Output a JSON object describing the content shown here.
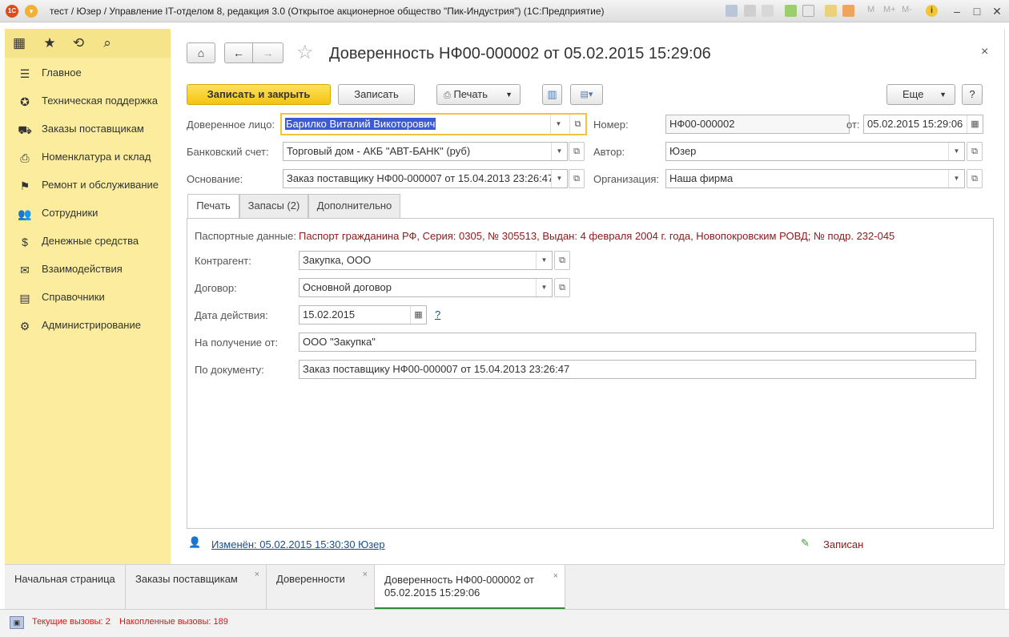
{
  "titlebar": {
    "title": "тест / Юзер / Управление IT-отделом 8, редакция 3.0 (Открытое акционерное общество \"Пик-Индустрия\")  (1С:Предприятие)",
    "icon_label": "1С"
  },
  "sidebar": {
    "items": [
      {
        "label": "Главное",
        "icon": "menu-lines-icon"
      },
      {
        "label": "Техническая поддержка",
        "icon": "support-icon"
      },
      {
        "label": "Заказы поставщикам",
        "icon": "truck-icon"
      },
      {
        "label": "Номенклатура и склад",
        "icon": "printer-icon"
      },
      {
        "label": "Ремонт и обслуживание",
        "icon": "flag-icon"
      },
      {
        "label": "Сотрудники",
        "icon": "people-icon"
      },
      {
        "label": "Денежные средства",
        "icon": "money-bag-icon"
      },
      {
        "label": "Взаимодействия",
        "icon": "envelope-icon"
      },
      {
        "label": "Справочники",
        "icon": "books-icon"
      },
      {
        "label": "Администрирование",
        "icon": "gear-icon"
      }
    ]
  },
  "form": {
    "title": "Доверенность НФ00-000002 от 05.02.2015 15:29:06",
    "toolbar": {
      "save_close": "Записать и закрыть",
      "save": "Записать",
      "print": "Печать",
      "more": "Еще",
      "help": "?"
    },
    "fields": {
      "trustee_label": "Доверенное лицо:",
      "trustee_value": "Барилко Виталий Викоторович",
      "bank_label": "Банковский счет:",
      "bank_value": "Торговый дом - АКБ \"АВТ-БАНК\" (руб)",
      "basis_label": "Основание:",
      "basis_value": "Заказ поставщику НФ00-000007 от 15.04.2013 23:26:47",
      "number_label": "Номер:",
      "number_value": "НФ00-000002",
      "date_label": "от:",
      "date_value": "05.02.2015 15:29:06",
      "author_label": "Автор:",
      "author_value": "Юзер",
      "org_label": "Организация:",
      "org_value": "Наша фирма"
    },
    "tabs": [
      "Печать",
      "Запасы (2)",
      "Дополнительно"
    ],
    "print_tab": {
      "passport_label": "Паспортные данные:",
      "passport_value": "Паспорт гражданина РФ,  Серия: 0305, № 305513, Выдан: 4 февраля 2004 г. года, Новопокровским РОВД; № подр. 232-045",
      "contractor_label": "Контрагент:",
      "contractor_value": "Закупка, ООО",
      "contract_label": "Договор:",
      "contract_value": "Основной договор",
      "valid_label": "Дата действия:",
      "valid_value": "15.02.2015",
      "valid_help": "?",
      "receive_label": "На получение от:",
      "receive_value": "ООО \"Закупка\"",
      "doc_label": "По документу:",
      "doc_value": "Заказ поставщику НФ00-000007 от 15.04.2013 23:26:47"
    },
    "footer": {
      "changed": "Изменён: 05.02.2015 15:30:30 Юзер",
      "state": "Записан"
    }
  },
  "open_tabs": [
    {
      "label": "Начальная страница"
    },
    {
      "label": "Заказы поставщикам"
    },
    {
      "label": "Доверенности"
    },
    {
      "label": "Доверенность НФ00-000002 от 05.02.2015 15:29:06"
    }
  ],
  "status": {
    "current_calls": "Текущие вызовы: 2",
    "accum_calls": "Накопленные вызовы: 189"
  },
  "colors": {
    "sidebar_bg": "#fbec9e",
    "accent_yellow": "#f5c518",
    "passport_text": "#8b1a1a",
    "link": "#1a4f8a",
    "status_red": "#d11",
    "active_tab_line": "#2e8b3a"
  }
}
